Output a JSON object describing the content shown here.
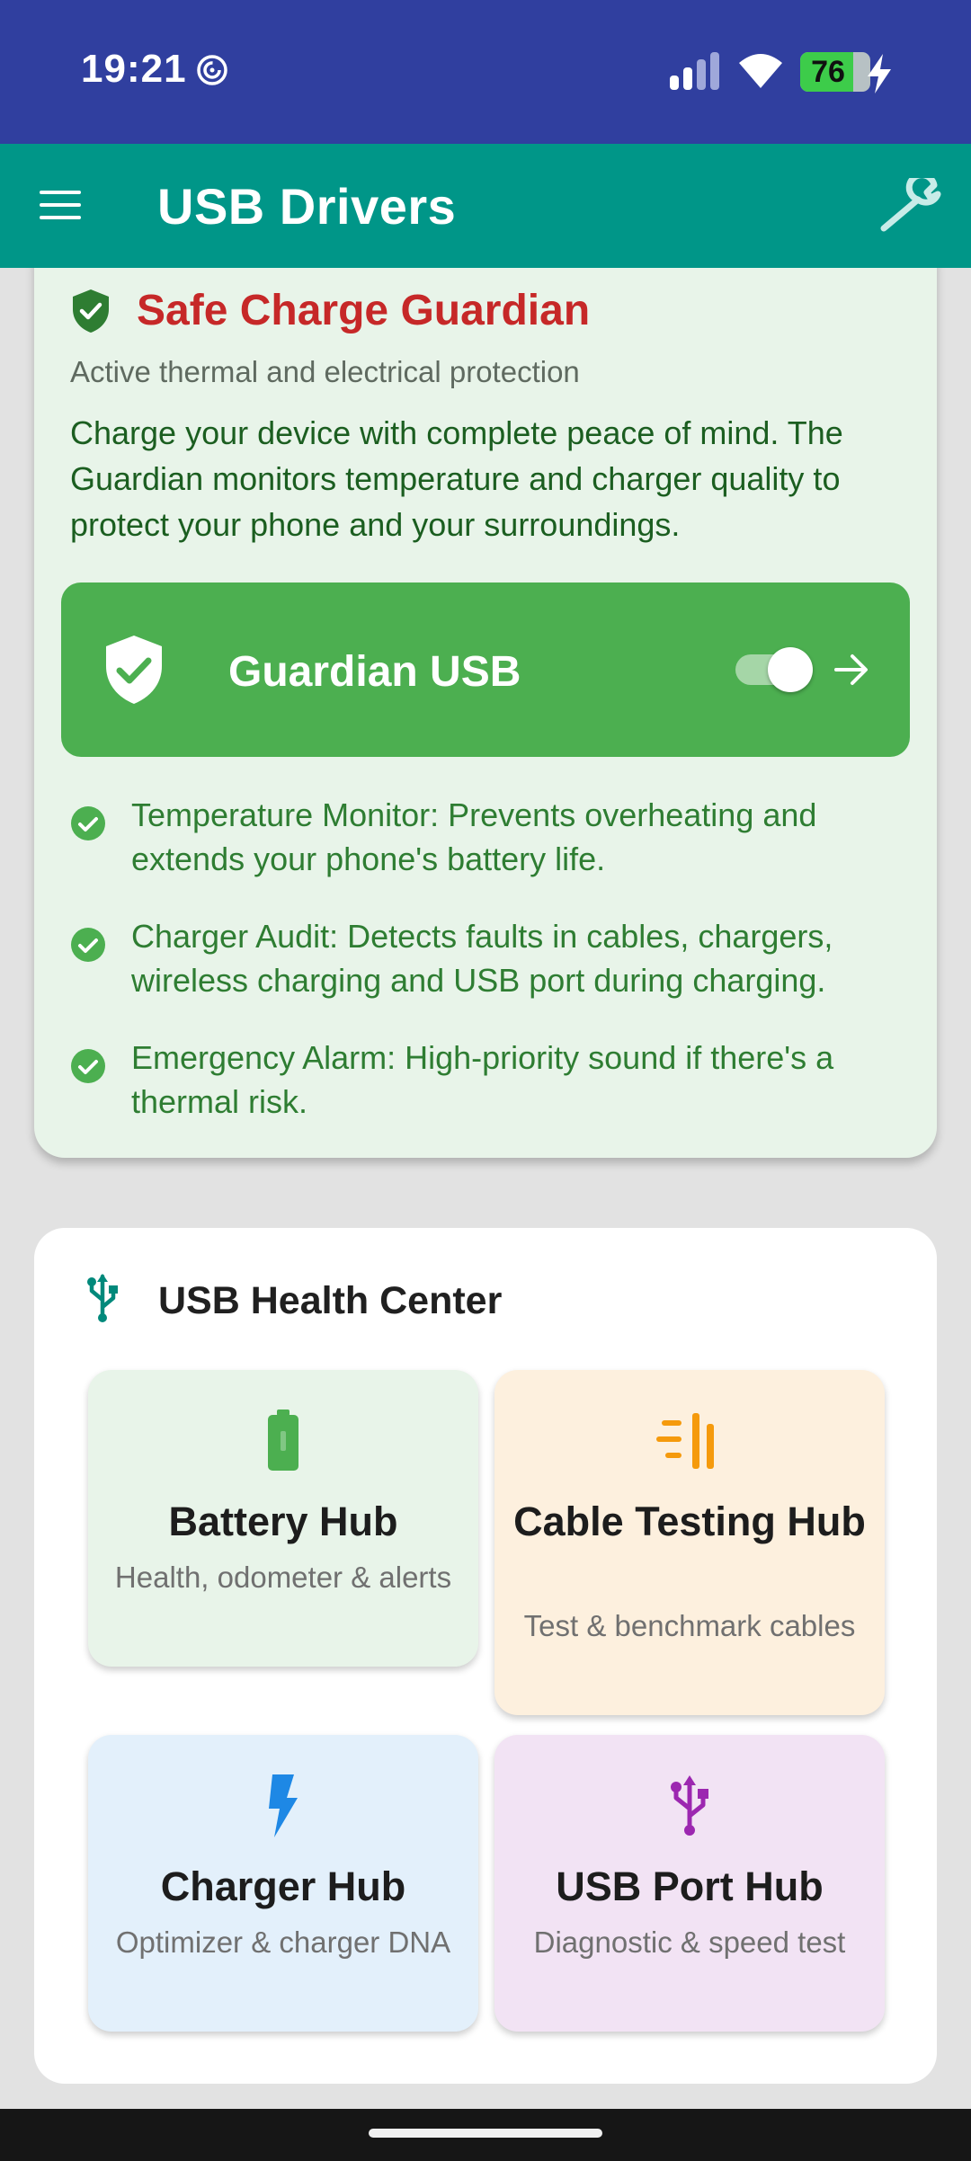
{
  "status_bar": {
    "time": "19:21",
    "battery_level": 76,
    "battery_text": "76"
  },
  "app_bar": {
    "title": "USB Drivers"
  },
  "guardian_card": {
    "title": "Safe Charge Guardian",
    "subtitle": "Active thermal and electrical protection",
    "description": "Charge your device with complete peace of mind. The Guardian monitors temperature and charger quality to protect your phone and your surroundings.",
    "guardian_toggle": {
      "label": "Guardian USB",
      "enabled": true
    },
    "features": [
      {
        "text": "Temperature Monitor: Prevents overheating and extends your phone's battery life."
      },
      {
        "text": "Charger Audit: Detects faults in cables, chargers, wireless charging and USB port during charging."
      },
      {
        "text": "Emergency Alarm: High-priority sound if there's a thermal risk."
      }
    ]
  },
  "health_center": {
    "title": "USB Health Center",
    "tiles": [
      {
        "title": "Battery Hub",
        "subtitle": "Health, odometer & alerts",
        "icon": "battery-icon",
        "bg": "#e8f4e9",
        "accent": "#4caf50"
      },
      {
        "title": "Cable Testing Hub",
        "subtitle": "Test & benchmark cables",
        "icon": "cable-test-icon",
        "bg": "#fdf0de",
        "accent": "#f59a0c"
      },
      {
        "title": "Charger Hub",
        "subtitle": "Optimizer & charger DNA",
        "icon": "bolt-icon",
        "bg": "#e3f0fb",
        "accent": "#1e88e5"
      },
      {
        "title": "USB Port Hub",
        "subtitle": "Diagnostic & speed test",
        "icon": "usb-icon",
        "bg": "#f2e3f4",
        "accent": "#9c27b0"
      }
    ]
  },
  "colors": {
    "status_bar": "#303f9f",
    "app_bar": "#009688",
    "guardian_title": "#c62828",
    "guardian_green": "#4caf50",
    "feature_text": "#2e7d32"
  }
}
